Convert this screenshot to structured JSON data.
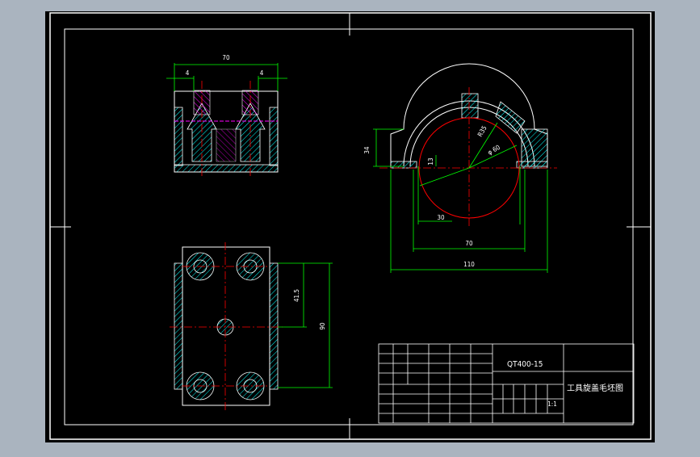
{
  "colors": {
    "background": "#aab4bf",
    "paper": "#000000",
    "line": "#ffffff",
    "hatch": "#00ffff",
    "dim": "#00ff00",
    "center": "#ff0000",
    "hidden": "#ff00ff"
  },
  "front_view": {
    "overall_width": "70",
    "left_offset": "4",
    "right_offset": "4"
  },
  "side_view": {
    "height": "34",
    "dim_13": "13",
    "radius_small": "R35",
    "dia_large": "φ 60",
    "bottom_inner": "30",
    "width_mid": "70",
    "width_total": "110"
  },
  "top_view": {
    "dim_inner": "41.5",
    "dim_outer": "90"
  },
  "title_block": {
    "material": "QT400-15",
    "part_name": "工具旋盖毛坯图",
    "scale": "1:1"
  }
}
